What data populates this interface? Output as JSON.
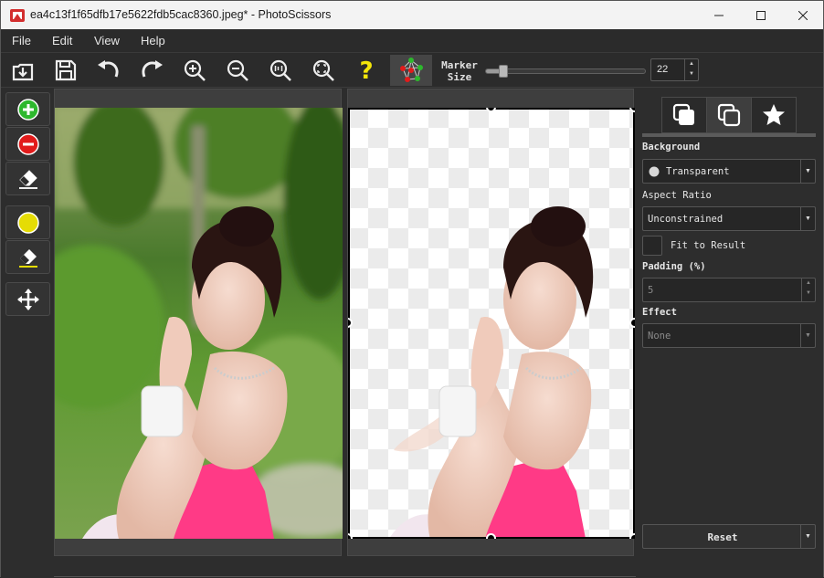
{
  "window": {
    "title": "ea4c13f1f65dfb17e5622fdb5cac8360.jpeg* - PhotoScissors"
  },
  "menu": [
    "File",
    "Edit",
    "View",
    "Help"
  ],
  "toolbar": {
    "marker_label_line1": "Marker",
    "marker_label_line2": "Size",
    "marker_size": "22",
    "marker_level_fraction": 0.08
  },
  "panel": {
    "background_label": "Background",
    "background_value": "Transparent",
    "aspect_label": "Aspect Ratio",
    "aspect_value": "Unconstrained",
    "fit_label": "Fit to Result",
    "padding_label": "Padding (%)",
    "padding_value": "5",
    "effect_label": "Effect",
    "effect_value": "None",
    "reset_label": "Reset"
  },
  "colors": {
    "accent_yellow": "#f4e50a",
    "marker_green": "#2db82d",
    "marker_red": "#e21b1b"
  }
}
